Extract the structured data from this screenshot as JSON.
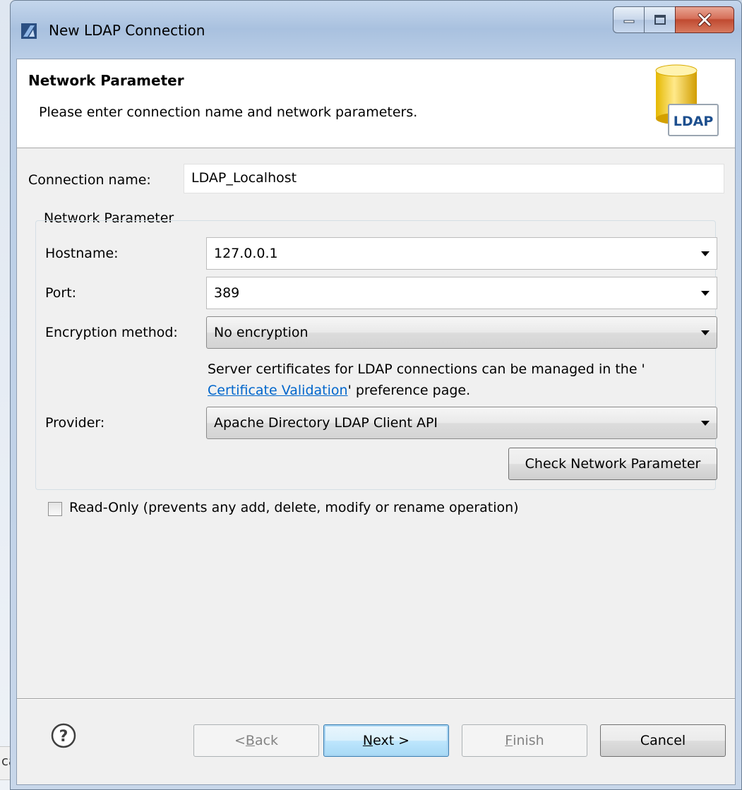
{
  "window": {
    "title": "New LDAP Connection"
  },
  "banner": {
    "title": "Network Parameter",
    "description": "Please enter connection name and network parameters.",
    "logo_text": "LDAP"
  },
  "connection": {
    "label": "Connection name:",
    "value": "LDAP_Localhost"
  },
  "network_group": {
    "title": "Network Parameter",
    "hostname_label": "Hostname:",
    "hostname_value": "127.0.0.1",
    "port_label": "Port:",
    "port_value": "389",
    "encryption_label": "Encryption method:",
    "encryption_value": "No encryption",
    "cert_note_prefix": "Server certificates for LDAP connections can be managed in the '",
    "cert_link": "Certificate Validation",
    "cert_note_suffix": "' preference page.",
    "provider_label": "Provider:",
    "provider_value": "Apache Directory LDAP Client API",
    "check_button": "Check Network Parameter"
  },
  "read_only": {
    "label": "Read-Only (prevents any add, delete, modify or rename operation)",
    "checked": false
  },
  "footer": {
    "back_pre": "< ",
    "back_key": "B",
    "back_post": "ack",
    "next_key": "N",
    "next_post": "ext >",
    "finish_key": "F",
    "finish_post": "inish",
    "cancel": "Cancel"
  },
  "background": {
    "fragment_text": "ca"
  },
  "colors": {
    "link": "#0066cc",
    "close_button": "#c04a31",
    "default_button_border": "#3c7fb1"
  }
}
